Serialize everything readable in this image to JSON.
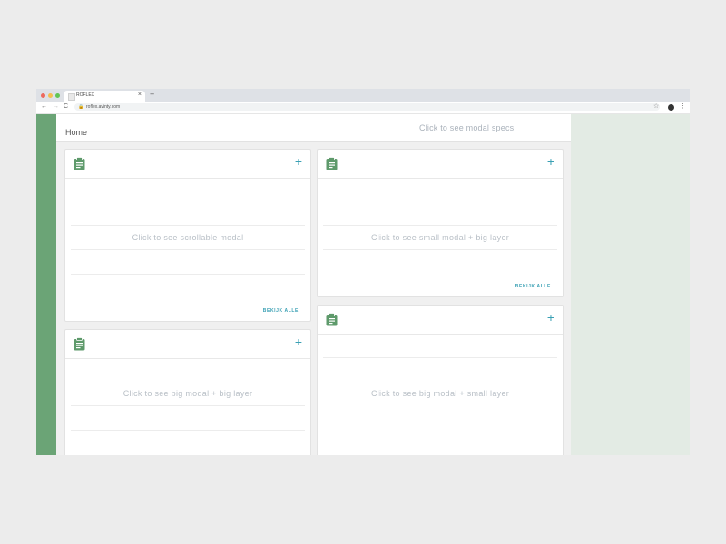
{
  "browser": {
    "tab_title": "ROFLEX",
    "tab_close": "×",
    "new_tab": "+",
    "back": "←",
    "forward": "→",
    "reload": "C",
    "lock": "🔒",
    "url": "roflex.avinty.com",
    "bookmark": "☆",
    "menu": "⋮",
    "traffic_colors": [
      "#ed6a5e",
      "#f5bf4f",
      "#62c554"
    ]
  },
  "app": {
    "page_title": "Home",
    "specs_link": "Click to see modal specs",
    "colors": {
      "sidebar": "#6ba476",
      "accent": "#3aa0b4",
      "icon": "#5e9a6b",
      "right_panel": "#e3ebe4"
    }
  },
  "cards": [
    {
      "icon": "clipboard-icon",
      "add": "+",
      "message": "Click to see scrollable modal",
      "link": "BEKIJK ALLE"
    },
    {
      "icon": "clipboard-icon",
      "add": "+",
      "message": "Click to see small modal + big layer",
      "link": "BEKIJK ALLE"
    },
    {
      "icon": "clipboard-icon",
      "add": "+",
      "message": "Click to see big modal + big layer"
    },
    {
      "icon": "clipboard-icon",
      "add": "+",
      "message": "Click to see big modal + small layer"
    }
  ]
}
